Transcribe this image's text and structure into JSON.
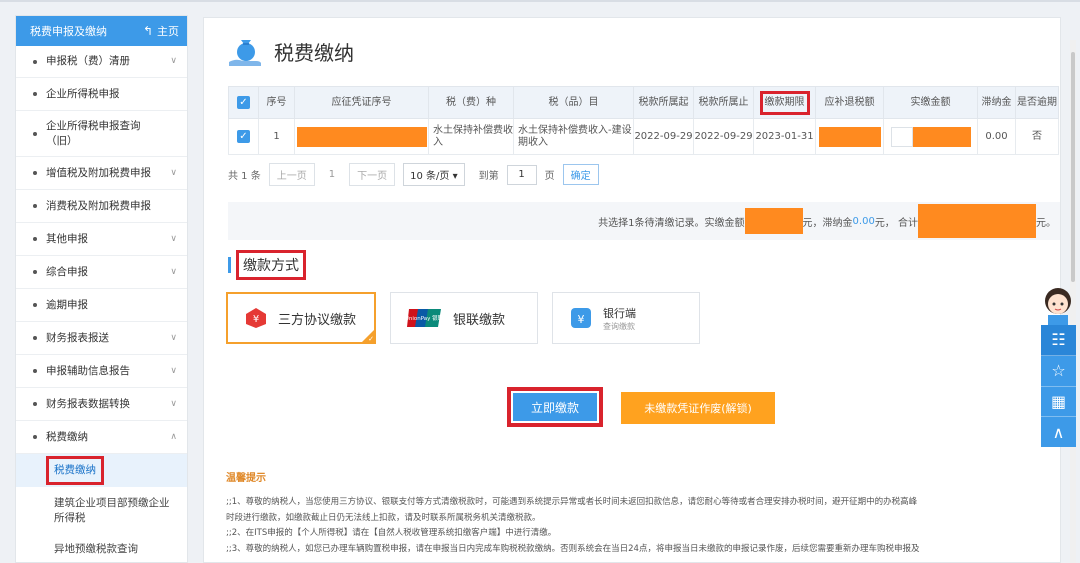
{
  "sidebar": {
    "header": "税费申报及缴纳",
    "home": "主页",
    "items": [
      {
        "label": "申报税（费）清册",
        "chevron": true
      },
      {
        "label": "企业所得税申报",
        "chevron": false
      },
      {
        "label": "企业所得税申报查询（旧）",
        "chevron": false
      },
      {
        "label": "增值税及附加税费申报",
        "chevron": true
      },
      {
        "label": "消费税及附加税费申报",
        "chevron": false
      },
      {
        "label": "其他申报",
        "chevron": true
      },
      {
        "label": "综合申报",
        "chevron": true
      },
      {
        "label": "逾期申报",
        "chevron": false
      },
      {
        "label": "财务报表报送",
        "chevron": true
      },
      {
        "label": "申报辅助信息报告",
        "chevron": true
      },
      {
        "label": "财务报表数据转换",
        "chevron": true
      },
      {
        "label": "税费缴纳",
        "chevron": true
      }
    ],
    "sub_items": [
      {
        "label": "税费缴纳"
      },
      {
        "label": "建筑企业项目部预缴企业所得税"
      },
      {
        "label": "异地预缴税款查询"
      }
    ]
  },
  "page": {
    "title": "税费缴纳"
  },
  "table": {
    "headers": [
      "序号",
      "应征凭证序号",
      "税（费）种",
      "税（品）目",
      "税款所属起",
      "税款所属止",
      "缴款期限",
      "应补退税额",
      "实缴金额",
      "滞纳金",
      "是否逾期"
    ],
    "row": {
      "index": "1",
      "tax_type": "水土保持补偿费收入",
      "tax_item": "水土保持补偿费收入-建设期收入",
      "period_start": "2022-09-29",
      "period_end": "2022-09-29",
      "deadline": "2023-01-31",
      "late_fee": "0.00",
      "overdue": "否"
    }
  },
  "pager": {
    "total": "共 1 条",
    "prev": "上一页",
    "current": "1",
    "next": "下一页",
    "page_size": "10 条/页",
    "goto": "到第",
    "goto_value": "1",
    "page_unit": "页",
    "confirm": "确定"
  },
  "summary": {
    "text1": "共选择1条待清缴记录。实缴金额",
    "text2": "元，滞纳金",
    "late_amount": "0.00",
    "text3": "元， 合计",
    "text4": "元。"
  },
  "payment": {
    "section_title": "缴款方式",
    "options": [
      {
        "label": "三方协议缴款"
      },
      {
        "label": "银联缴款",
        "logo_text": "UnionPay 银联"
      },
      {
        "label": "银行端",
        "sub": "查询缴款"
      }
    ]
  },
  "buttons": {
    "pay_now": "立即缴款",
    "void": "未缴款凭证作废(解锁)"
  },
  "tips": {
    "title": "温馨提示",
    "lines": [
      ";;1、尊敬的纳税人，当您使用三方协议、银联支付等方式清缴税款时，可能遇到系统提示异常或者长时间未返回扣款信息，请您耐心等待或者合理安排办税时间，避开征期中的办税高峰",
      "时段进行缴款，如缴款截止日仍无法线上扣款，请及时联系所属税务机关清缴税款。",
      ";;2、在ITS申报的【个人所得税】请在【自然人税收管理系统扣缴客户端】中进行清缴。",
      ";;3、尊敬的纳税人，如您已办理车辆购置税申报，请在申报当日内完成车购税税款缴纳。否则系统会在当日24点，将申报当日未缴款的申报记录作废，后续您需要重新办理车购税申报及"
    ]
  },
  "colors": {
    "accent": "#3d9ae8",
    "highlight": "#d9232d",
    "mask": "#ff8a1f",
    "warn": "#ffa21f"
  }
}
